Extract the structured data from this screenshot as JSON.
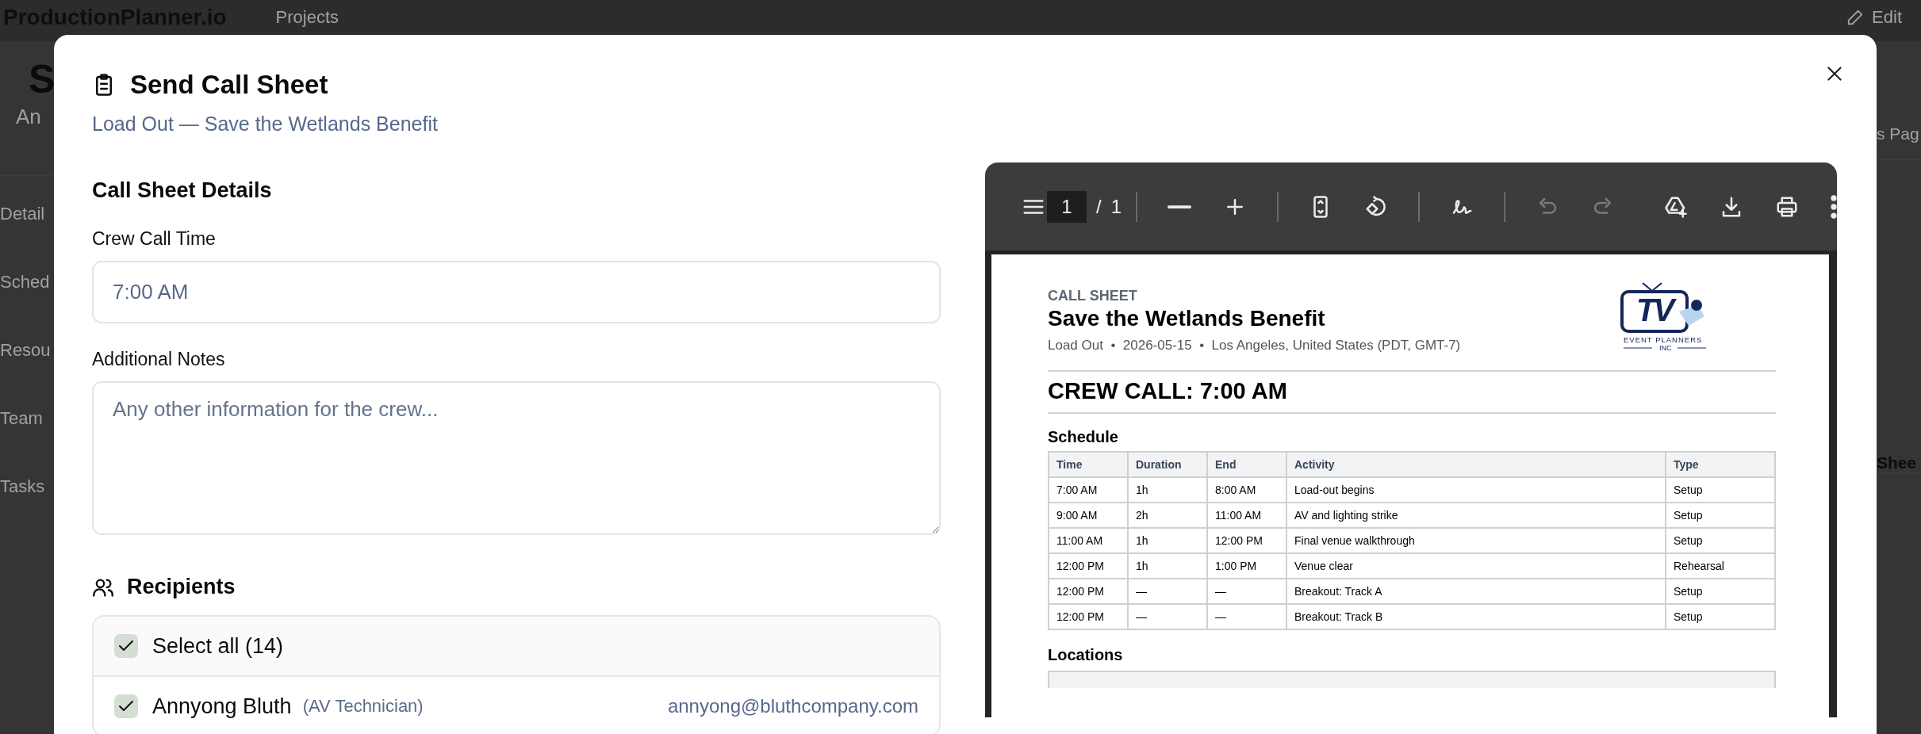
{
  "backdrop": {
    "app_name": "ProductionPlanner.io",
    "nav_link": "Projects",
    "edit_button": "Edit",
    "page_title": "S",
    "page_subtitle": "An",
    "nav_tabs": [
      "Detail",
      "Sched",
      "Resou",
      "Team",
      "Tasks"
    ],
    "right_panel_texts": [
      "s Pag",
      "Shee"
    ]
  },
  "dialog": {
    "title": "Send Call Sheet",
    "subtitle": "Load Out — Save the Wetlands Benefit",
    "section_title": "Call Sheet Details",
    "fields": [
      {
        "kind": "input",
        "label": "Crew Call Time",
        "value": "7:00 AM"
      },
      {
        "kind": "textarea",
        "label": "Additional Notes",
        "placeholder": "Any other information for the crew..."
      }
    ],
    "recipients": {
      "title": "Recipients",
      "select_all": {
        "label": "Select all (14)",
        "checked": true
      },
      "items": [
        {
          "name": "Annyong Bluth",
          "role": "(AV Technician)",
          "email": "annyong@bluthcompany.com",
          "checked": true
        }
      ]
    }
  },
  "pdf_viewer": {
    "page_input": "1",
    "page_separator": "/",
    "page_total": "1",
    "tool_groups": [
      [
        {
          "kind": "zoom-out",
          "disabled": false
        },
        {
          "kind": "zoom-in",
          "disabled": false
        }
      ],
      [
        {
          "kind": "fit-page",
          "disabled": false
        },
        {
          "kind": "rotate",
          "disabled": false
        }
      ],
      [
        {
          "kind": "annotate",
          "disabled": false
        }
      ],
      [
        {
          "kind": "undo",
          "disabled": true
        },
        {
          "kind": "redo",
          "disabled": true
        }
      ]
    ],
    "right_tools": [
      {
        "kind": "add-to-drive",
        "disabled": false
      },
      {
        "kind": "download",
        "disabled": false
      },
      {
        "kind": "print",
        "disabled": false
      },
      {
        "kind": "more",
        "disabled": false
      }
    ],
    "document": {
      "label": "CALL SHEET",
      "title": "Save the Wetlands Benefit",
      "meta": "Load Out  •  2026-05-15  •  Los Angeles, United States (PDT, GMT-7)",
      "logo": {
        "mark": "TV",
        "name": "EVENT PLANNERS",
        "suffix": "INC"
      },
      "crew_call": "CREW CALL: 7:00 AM",
      "schedule_title": "Schedule",
      "columns": [
        "Time",
        "Duration",
        "End",
        "Activity",
        "Type"
      ],
      "rows": [
        [
          "7:00 AM",
          "1h",
          "8:00 AM",
          "Load-out begins",
          "Setup"
        ],
        [
          "9:00 AM",
          "2h",
          "11:00 AM",
          "AV and lighting strike",
          "Setup"
        ],
        [
          "11:00 AM",
          "1h",
          "12:00 PM",
          "Final venue walkthrough",
          "Setup"
        ],
        [
          "12:00 PM",
          "1h",
          "1:00 PM",
          "Venue clear",
          "Rehearsal"
        ],
        [
          "12:00 PM",
          "—",
          "—",
          "Breakout: Track A",
          "Setup"
        ],
        [
          "12:00 PM",
          "—",
          "—",
          "Breakout: Track B",
          "Setup"
        ]
      ],
      "locations_title": "Locations"
    }
  }
}
